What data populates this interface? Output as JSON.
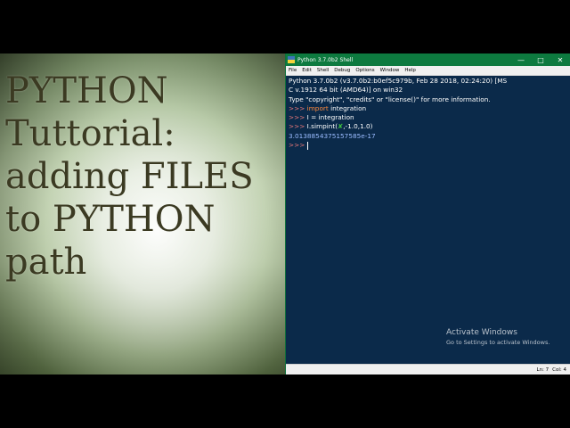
{
  "overlay": {
    "title_lines": "PYTHON\nTuttorial:\nadding FILES\nto PYTHON\npath"
  },
  "window": {
    "title": "Python 3.7.0b2 Shell",
    "controls": {
      "minimize": "—",
      "maximize": "□",
      "close": "✕"
    }
  },
  "menu": [
    "File",
    "Edit",
    "Shell",
    "Debug",
    "Options",
    "Window",
    "Help"
  ],
  "shell": {
    "banner1": "Python 3.7.0b2 (v3.7.0b2:b0ef5c979b, Feb 28 2018, 02:24:20) [MS",
    "banner2": "C v.1912 64 bit (AMD64)] on win32",
    "banner3": "Type \"copyright\", \"credits\" or \"license()\" for more information.",
    "prompt": ">>> ",
    "cmd1_kw": "import",
    "cmd1_rest": " integration",
    "cmd2": "I = integration",
    "cmd3_a": "I.simpint(",
    "cmd3_b": "✘",
    "cmd3_c": ",-1.0,1.0)",
    "output": "3.0138854375157585e-17"
  },
  "watermark": {
    "line1": "Activate Windows",
    "line2": "Go to Settings to activate Windows."
  },
  "status": {
    "ln": "Ln: 7",
    "col": "Col: 4"
  }
}
